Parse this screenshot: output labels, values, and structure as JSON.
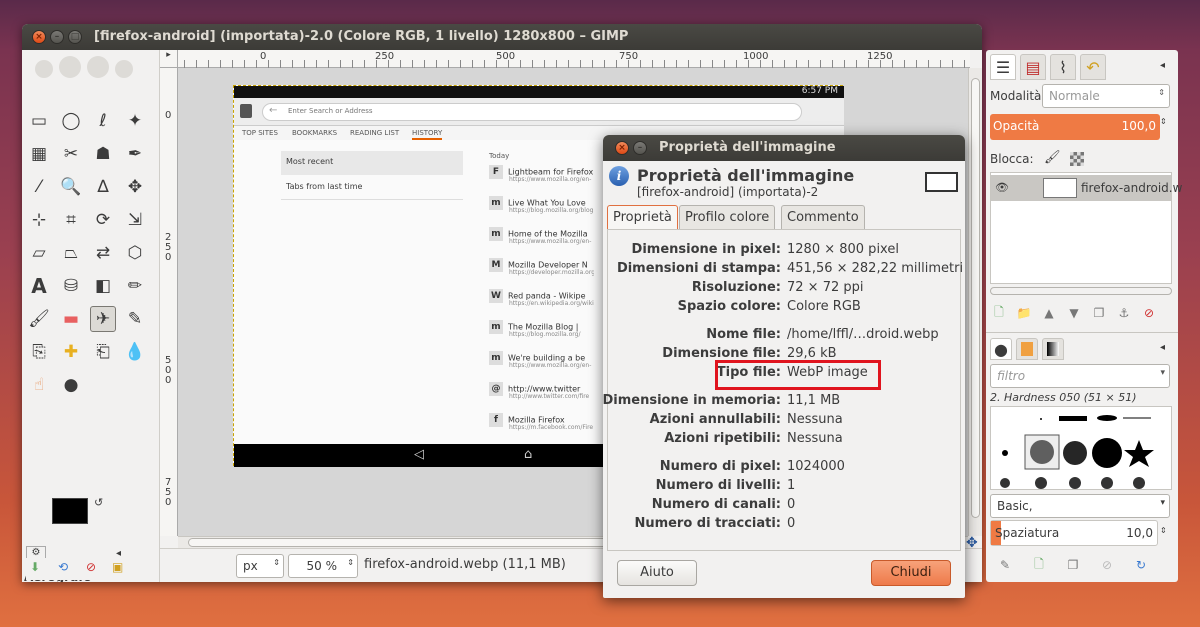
{
  "window": {
    "title": "[firefox-android] (importata)-2.0 (Colore RGB, 1 livello) 1280x800 – GIMP"
  },
  "ruler": {
    "marks": [
      "0",
      "250",
      "500",
      "750",
      "1000",
      "1250"
    ],
    "left_marks": [
      "0",
      "250",
      "500",
      "750"
    ]
  },
  "toolbox": {
    "tool_options_label": "Aerografo"
  },
  "statusbar": {
    "unit": "px",
    "zoom": "50 %",
    "file_info": "firefox-android.webp (11,1 MB)"
  },
  "image": {
    "time": "6:57 PM",
    "url_placeholder": "Enter Search or Address",
    "tabs": [
      "TOP SITES",
      "BOOKMARKS",
      "READING LIST",
      "HISTORY"
    ],
    "left_items": [
      "Most recent",
      "Tabs from last time"
    ],
    "today": "Today",
    "history": [
      {
        "icon": "F",
        "title": "Lightbeam for Firefox",
        "url": "https://www.mozilla.org/en-"
      },
      {
        "icon": "m",
        "title": "Live What You Love",
        "url": "https://blog.mozilla.org/blog"
      },
      {
        "icon": "m",
        "title": "Home of the Mozilla",
        "url": "https://www.mozilla.org/en-"
      },
      {
        "icon": "M",
        "title": "Mozilla Developer N",
        "url": "https://developer.mozilla.org"
      },
      {
        "icon": "W",
        "title": "Red panda - Wikipe",
        "url": "https://en.wikipedia.org/wiki"
      },
      {
        "icon": "m",
        "title": "The Mozilla Blog |",
        "url": "https://blog.mozilla.org/"
      },
      {
        "icon": "m",
        "title": "We're building a be",
        "url": "https://www.mozilla.org/en-"
      },
      {
        "icon": "@",
        "title": "http://www.twitter",
        "url": "http://www.twitter.com/fire"
      },
      {
        "icon": "f",
        "title": "Mozilla Firefox",
        "url": "https://m.facebook.com/Fire"
      }
    ]
  },
  "dock": {
    "mode_label": "Modalità:",
    "mode_value": "Normale",
    "opacity_label": "Opacità",
    "opacity_value": "100,0",
    "lock_label": "Blocca:",
    "layer_name": "firefox-android.w",
    "brush_filter_placeholder": "filtro",
    "brush_name": "2. Hardness 050 (51 × 51)",
    "brush_set": "Basic,",
    "spacing_label": "Spaziatura",
    "spacing_value": "10,0"
  },
  "dialog": {
    "title": "Proprietà dell'immagine",
    "heading": "Proprietà dell'immagine",
    "subheading": "[firefox-android] (importata)-2",
    "tabs": [
      "Proprietà",
      "Profilo colore",
      "Commento"
    ],
    "properties": [
      {
        "label": "Dimensione in pixel:",
        "value": "1280 × 800 pixel"
      },
      {
        "label": "Dimensioni di stampa:",
        "value": "451,56 × 282,22 millimetri"
      },
      {
        "label": "Risoluzione:",
        "value": "72 × 72 ppi"
      },
      {
        "label": "Spazio colore:",
        "value": "Colore RGB"
      },
      {
        "label": "Nome file:",
        "value": "/home/lffl/…droid.webp"
      },
      {
        "label": "Dimensione file:",
        "value": "29,6 kB"
      },
      {
        "label": "Tipo file:",
        "value": "WebP image"
      },
      {
        "label": "Dimensione in memoria:",
        "value": "11,1 MB"
      },
      {
        "label": "Azioni annullabili:",
        "value": "Nessuna"
      },
      {
        "label": "Azioni ripetibili:",
        "value": "Nessuna"
      },
      {
        "label": "Numero di pixel:",
        "value": "1024000"
      },
      {
        "label": "Numero di livelli:",
        "value": "1"
      },
      {
        "label": "Numero di canali:",
        "value": "0"
      },
      {
        "label": "Numero di tracciati:",
        "value": "0"
      }
    ],
    "help_button": "Aiuto",
    "close_button": "Chiudi"
  }
}
